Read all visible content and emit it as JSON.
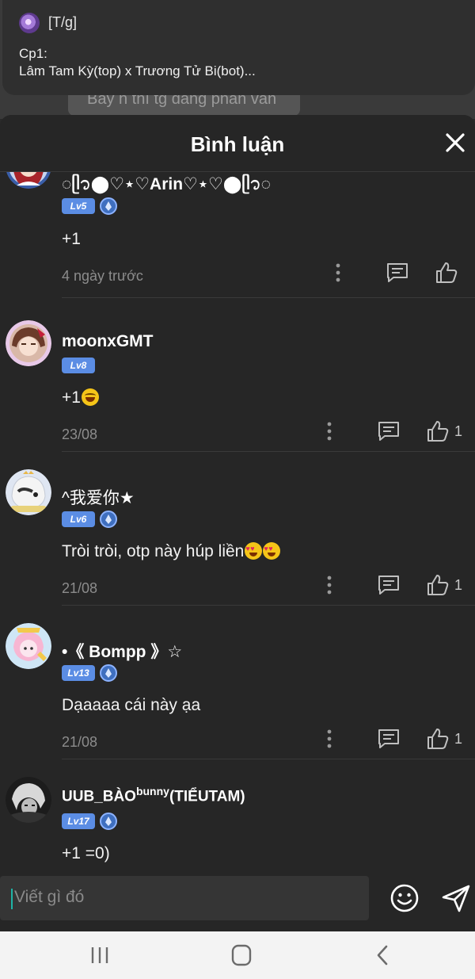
{
  "notification": {
    "app_tag": "[T/g]",
    "title": "Cp1:",
    "body": "Lâm Tam Kỳ(top) x Trương Tử Bi(bot)..."
  },
  "background": {
    "partial_text": "Bây h thì tg đang phân vân"
  },
  "panel": {
    "title": "Bình luận"
  },
  "comments": [
    {
      "username": "◌ᥫ᭡⬤♡⋆♡Arin♡⋆♡⬤ᥫ᭡◌",
      "level": "Lv5",
      "badge": true,
      "text": "+1",
      "emoji": "",
      "date": "4 ngày trước",
      "likes": ""
    },
    {
      "username": "moonxGMT",
      "level": "Lv8",
      "badge": false,
      "text": "+1",
      "emoji": "laugh",
      "date": "23/08",
      "likes": "1"
    },
    {
      "username": "^我爱你★",
      "level": "Lv6",
      "badge": true,
      "text": "Tròi tròi, otp này húp liền",
      "emoji": "love",
      "date": "21/08",
      "likes": "1"
    },
    {
      "username": "•《 Bompp 》☆",
      "level": "Lv13",
      "badge": true,
      "text": "Dạaaaa cái này ạa",
      "emoji": "",
      "date": "21/08",
      "likes": "1"
    },
    {
      "username_main": "UUB_BÀO",
      "username_sup": "bunny",
      "username_tail": "(TIỂUTAM)",
      "level": "Lv17",
      "badge": true,
      "text": "+1 =0)",
      "emoji": "",
      "date": "",
      "likes": ""
    }
  ],
  "input": {
    "placeholder": "Viết gì đó"
  },
  "icons": {
    "close": "close-icon",
    "more": "more-vertical-icon",
    "reply": "comment-icon",
    "like": "thumbs-up-icon",
    "emoji": "smiley-icon",
    "send": "send-icon",
    "nav_recents": "recents-icon",
    "nav_home": "home-icon",
    "nav_back": "back-icon"
  },
  "colors": {
    "level_badge": "#5b8de4",
    "caret": "#1fb3a6",
    "panel_bg": "#262626"
  }
}
